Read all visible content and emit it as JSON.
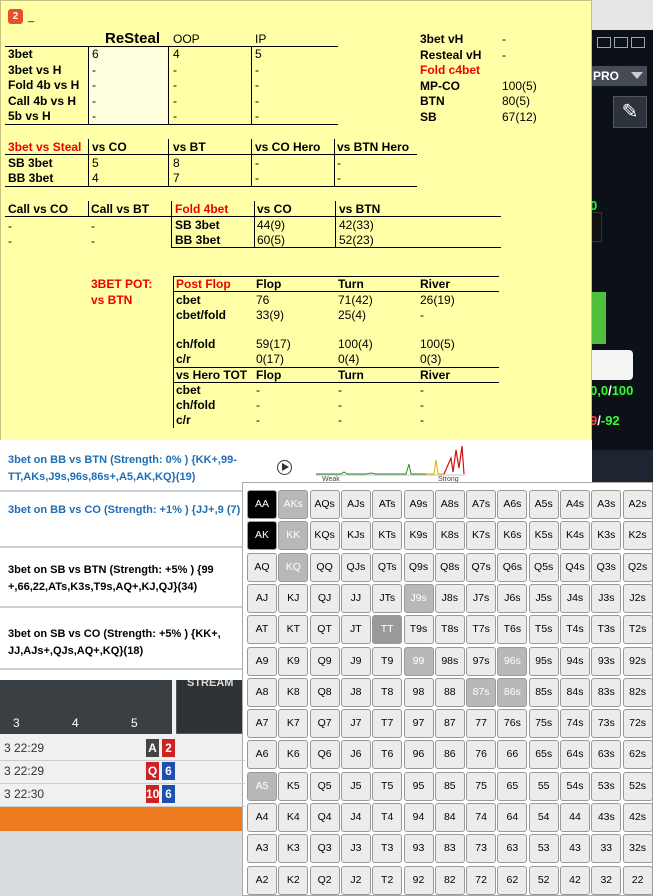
{
  "window": {
    "app_icon": "2",
    "title": "_"
  },
  "background": {
    "pro_label": "PRO",
    "green_digit": "0",
    "score_line1": [
      "0,0",
      "/",
      "100"
    ],
    "score_line2": [
      "9",
      "/",
      "-92"
    ]
  },
  "resteal": {
    "headers": [
      "ReSteal",
      "OOP",
      "IP"
    ],
    "rows": [
      {
        "label": "3bet",
        "vals": [
          "6",
          "4",
          "5"
        ]
      },
      {
        "label": "3bet vs H",
        "vals": [
          "-",
          "-",
          "-"
        ]
      },
      {
        "label": "Fold 4b vs H",
        "vals": [
          "-",
          "-",
          "-"
        ]
      },
      {
        "label": "Call 4b vs H",
        "vals": [
          "-",
          "-",
          "-"
        ]
      },
      {
        "label": "5b vs H",
        "vals": [
          "-",
          "-",
          "-"
        ]
      }
    ]
  },
  "side_stats": [
    {
      "label": "3bet vH",
      "value": "-"
    },
    {
      "label": "Resteal vH",
      "value": "-"
    },
    {
      "label": "Fold c4bet",
      "value": ""
    },
    {
      "label": "MP-CO",
      "value": "100(5)"
    },
    {
      "label": "BTN",
      "value": "80(5)"
    },
    {
      "label": "SB",
      "value": "67(12)"
    }
  ],
  "vs_steal": {
    "headers": [
      "3bet vs Steal",
      "vs CO",
      "vs BT",
      "vs CO Hero",
      "vs BTN Hero"
    ],
    "rows": [
      {
        "label": "SB 3bet",
        "vals": [
          "5",
          "8",
          "-",
          "-"
        ]
      },
      {
        "label": "BB 3bet",
        "vals": [
          "4",
          "7",
          "-",
          "-"
        ]
      }
    ]
  },
  "calls": {
    "headers": [
      "Call vs CO",
      "Call vs BT"
    ],
    "vals": [
      "-",
      "-"
    ]
  },
  "fold4bet": {
    "headers": [
      "Fold 4bet",
      "vs CO",
      "vs BTN"
    ],
    "rows": [
      {
        "label": "SB 3bet",
        "vals": [
          "44(9)",
          "42(33)"
        ]
      },
      {
        "label": "BB 3bet",
        "vals": [
          "60(5)",
          "52(23)"
        ]
      }
    ]
  },
  "pot": {
    "title1": "3BET POT:",
    "title2": "vs BTN",
    "headers": [
      "Post Flop",
      "Flop",
      "Turn",
      "River"
    ],
    "rows": [
      {
        "label": "cbet",
        "vals": [
          "76",
          "71(42)",
          "26(19)"
        ]
      },
      {
        "label": "cbet/fold",
        "vals": [
          "33(9)",
          "25(4)",
          "-"
        ]
      },
      {
        "label": "ch/fold",
        "vals": [
          "59(17)",
          "100(4)",
          "100(5)"
        ]
      },
      {
        "label": "c/r",
        "vals": [
          "0(17)",
          "0(4)",
          "0(3)"
        ]
      }
    ],
    "hero_headers": [
      "vs Hero TOT",
      "Flop",
      "Turn",
      "River"
    ],
    "hero_rows": [
      {
        "label": "cbet",
        "vals": [
          "-",
          "-",
          "-"
        ]
      },
      {
        "label": "ch/fold",
        "vals": [
          "-",
          "-",
          "-"
        ]
      },
      {
        "label": "c/r",
        "vals": [
          "-",
          "-",
          "-"
        ]
      }
    ]
  },
  "strategies": [
    {
      "text": "3bet on BB vs BTN (Strength: 0% ) {KK+,99-TT,AKs,J9s,96s,86s+,A5,AK,KQ}(19)",
      "color": "#1f6eb5"
    },
    {
      "text": "3bet on BB vs CO (Strength: +1% ) {JJ+,9 (7)",
      "color": "#1f6eb5"
    },
    {
      "text": "3bet on SB vs BTN (Strength: +5% ) {99 +,66,22,ATs,K3s,T9s,AQ+,KJ,QJ}(34)",
      "color": "#000000"
    },
    {
      "text": "3bet on SB vs CO (Strength: +5% ) {KK+, JJ,AJs+,QJs,AQ+,KQ}(18)",
      "color": "#000000"
    }
  ],
  "graph_labels": [
    "Weak",
    "Strong"
  ],
  "timeline": {
    "ticks": [
      "3",
      "4",
      "5"
    ],
    "stream_label": "STREAM"
  },
  "log": [
    {
      "time": "3 22:29",
      "cards": [
        {
          "v": "A",
          "c": "#444"
        },
        {
          "v": "2",
          "c": "#c22"
        }
      ]
    },
    {
      "time": "3 22:29",
      "cards": [
        {
          "v": "Q",
          "c": "#c22"
        },
        {
          "v": "6",
          "c": "#1d4fb0"
        }
      ]
    },
    {
      "time": "3 22:30",
      "cards": [
        {
          "v": "10",
          "c": "#c22"
        },
        {
          "v": "6",
          "c": "#1d4fb0"
        }
      ]
    }
  ],
  "range_grid": {
    "rows": [
      [
        "AA",
        "AKs",
        "AQs",
        "AJs",
        "ATs",
        "A9s",
        "A8s",
        "A7s",
        "A6s",
        "A5s",
        "A4s",
        "A3s",
        "A2s"
      ],
      [
        "AK",
        "KK",
        "KQs",
        "KJs",
        "KTs",
        "K9s",
        "K8s",
        "K7s",
        "K6s",
        "K5s",
        "K4s",
        "K3s",
        "K2s"
      ],
      [
        "AQ",
        "KQ",
        "QQ",
        "QJs",
        "QTs",
        "Q9s",
        "Q8s",
        "Q7s",
        "Q6s",
        "Q5s",
        "Q4s",
        "Q3s",
        "Q2s"
      ],
      [
        "AJ",
        "KJ",
        "QJ",
        "JJ",
        "JTs",
        "J9s",
        "J8s",
        "J7s",
        "J6s",
        "J5s",
        "J4s",
        "J3s",
        "J2s"
      ],
      [
        "AT",
        "KT",
        "QT",
        "JT",
        "TT",
        "T9s",
        "T8s",
        "T7s",
        "T6s",
        "T5s",
        "T4s",
        "T3s",
        "T2s"
      ],
      [
        "A9",
        "K9",
        "Q9",
        "J9",
        "T9",
        "99",
        "98s",
        "97s",
        "96s",
        "95s",
        "94s",
        "93s",
        "92s"
      ],
      [
        "A8",
        "K8",
        "Q8",
        "J8",
        "T8",
        "98",
        "88",
        "87s",
        "86s",
        "85s",
        "84s",
        "83s",
        "82s"
      ],
      [
        "A7",
        "K7",
        "Q7",
        "J7",
        "T7",
        "97",
        "87",
        "77",
        "76s",
        "75s",
        "74s",
        "73s",
        "72s"
      ],
      [
        "A6",
        "K6",
        "Q6",
        "J6",
        "T6",
        "96",
        "86",
        "76",
        "66",
        "65s",
        "64s",
        "63s",
        "62s"
      ],
      [
        "A5",
        "K5",
        "Q5",
        "J5",
        "T5",
        "95",
        "85",
        "75",
        "65",
        "55",
        "54s",
        "53s",
        "52s"
      ],
      [
        "A4",
        "K4",
        "Q4",
        "J4",
        "T4",
        "94",
        "84",
        "74",
        "64",
        "54",
        "44",
        "43s",
        "42s"
      ],
      [
        "A3",
        "K3",
        "Q3",
        "J3",
        "T3",
        "93",
        "83",
        "73",
        "63",
        "53",
        "43",
        "33",
        "32s"
      ],
      [
        "A2",
        "K2",
        "Q2",
        "J2",
        "T2",
        "92",
        "82",
        "72",
        "62",
        "52",
        "42",
        "32",
        "22"
      ]
    ],
    "full": [
      "AA",
      "AK"
    ],
    "partial": [
      "AKs",
      "KK",
      "KQ",
      "J9s",
      "99",
      "96s",
      "87s",
      "86s",
      "A5"
    ],
    "mid": [
      "TT"
    ]
  }
}
